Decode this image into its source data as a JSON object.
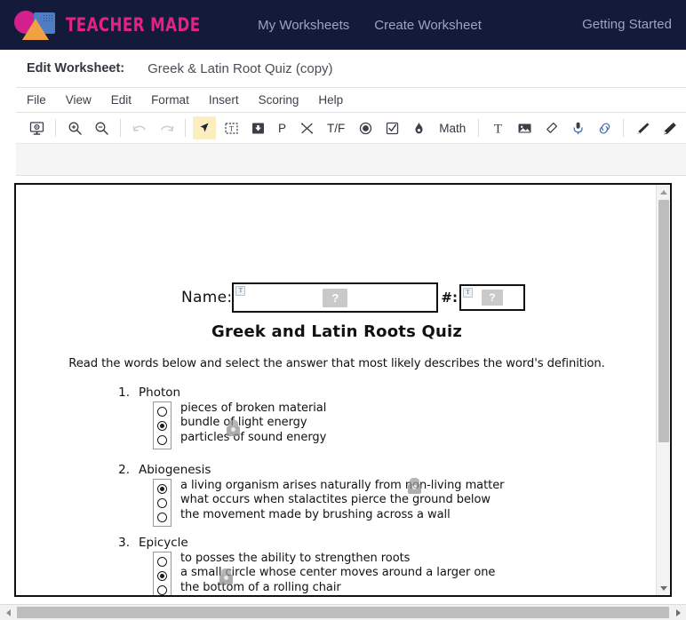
{
  "topnav": {
    "brand_name": "TEACHER MADE",
    "links": [
      {
        "label": "My Worksheets"
      },
      {
        "label": "Create Worksheet"
      }
    ],
    "right_link": "Getting Started",
    "bg_color": "#131a3a",
    "brand_color": "#e5227f"
  },
  "titlebar": {
    "label": "Edit Worksheet:",
    "worksheet_name": "Greek & Latin Root Quiz (copy)"
  },
  "menubar": {
    "items": [
      {
        "label": "File"
      },
      {
        "label": "View"
      },
      {
        "label": "Edit"
      },
      {
        "label": "Format"
      },
      {
        "label": "Insert"
      },
      {
        "label": "Scoring"
      },
      {
        "label": "Help"
      }
    ]
  },
  "toolbar": {
    "math_label": "Math",
    "p_label": "P",
    "tf_label": "T/F",
    "active_tool": "select-arrow-tool"
  },
  "worksheet": {
    "name_label": "Name:",
    "hash_label": "#:",
    "placeholder_mark": "?",
    "field_badge": "T",
    "title": "Greek and Latin Roots Quiz",
    "instructions": "Read the words below and select the answer that most likely describes the word's definition.",
    "questions": [
      {
        "number": "1.",
        "word": "Photon",
        "options": [
          {
            "text": "pieces of broken material",
            "selected": false
          },
          {
            "text": "bundle of light energy",
            "selected": true
          },
          {
            "text": "particles of sound energy",
            "selected": false
          }
        ]
      },
      {
        "number": "2.",
        "word": "Abiogenesis",
        "options": [
          {
            "text": "a living organism arises naturally from non-living matter",
            "selected": true
          },
          {
            "text": "what occurs when stalactites pierce the ground below",
            "selected": false
          },
          {
            "text": "the movement made by brushing across a wall",
            "selected": false
          }
        ]
      },
      {
        "number": "3.",
        "word": "Epicycle",
        "options": [
          {
            "text": "to posses the ability to strengthen roots",
            "selected": false
          },
          {
            "text": "a small circle whose center moves around a larger one",
            "selected": true
          },
          {
            "text": "the bottom of a rolling chair",
            "selected": false
          }
        ]
      }
    ]
  }
}
